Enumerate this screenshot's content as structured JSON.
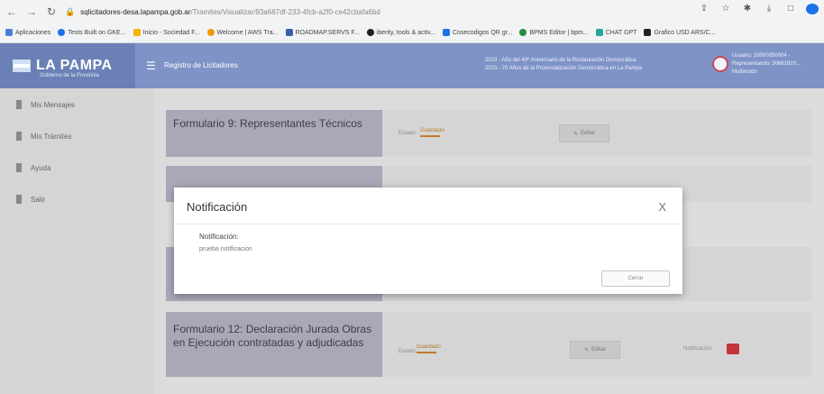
{
  "browser": {
    "url_host": "sqlicitadores-desa.lapampa.gob.ar",
    "url_path": "/Tramites/Visualizar/93a687df-233-4fcb-a2f0-ce42cbafa6bd",
    "bookmarks": [
      "Aplicaciones",
      "Tests Built on GKE...",
      "Inicio - Sociedad F...",
      "Welcome | AWS Tra...",
      "ROADMAP.SERVS F...",
      "iberity, tools & activ...",
      "Cosecodigos QR gr...",
      "BPMS Editor | bpm...",
      "CHAT GPT",
      "Grafico USD ARS/C..."
    ]
  },
  "header": {
    "logo": "LA PAMPA",
    "logo_sub": "Gobierno de la Provincia",
    "app_title": "Registro de Licitadores",
    "anniv_line1": "2023 - Año del 40º Aniversario de la Restauración Democrática",
    "anniv_line2": "2023 - 70 Años de la Provincialización Democrática en La Pampa",
    "user_line1": "Usuario: 20000050004 -",
    "user_line2": "Representando: 30661920...",
    "user_line3": "Multimodo"
  },
  "sidebar": {
    "items": [
      {
        "label": "Mis Mensajes"
      },
      {
        "label": "Mis Trámites"
      },
      {
        "label": "Ayuda"
      },
      {
        "label": "Salir"
      }
    ]
  },
  "cards": [
    {
      "title": "Formulario 9: Representantes Técnicos",
      "estado_label": "Estado:",
      "estado_value": "Guardado",
      "edit_label": "Editar"
    },
    {
      "title": "Formulario 12: Declaración Jurada Obras en Ejecución contratadas y adjudicadas",
      "estado_label": "Estado:",
      "estado_value": "Guardado",
      "edit_label": "Editar",
      "notif_label": "Notificación:"
    }
  ],
  "modal": {
    "title": "Notificación",
    "close": "X",
    "field_label": "Notificación:",
    "field_value": "prueba notificacion",
    "close_button": "Cerrar"
  },
  "colors": {
    "header": "#7e93c6",
    "status": "#c47a27",
    "notification": "#c4343b"
  }
}
